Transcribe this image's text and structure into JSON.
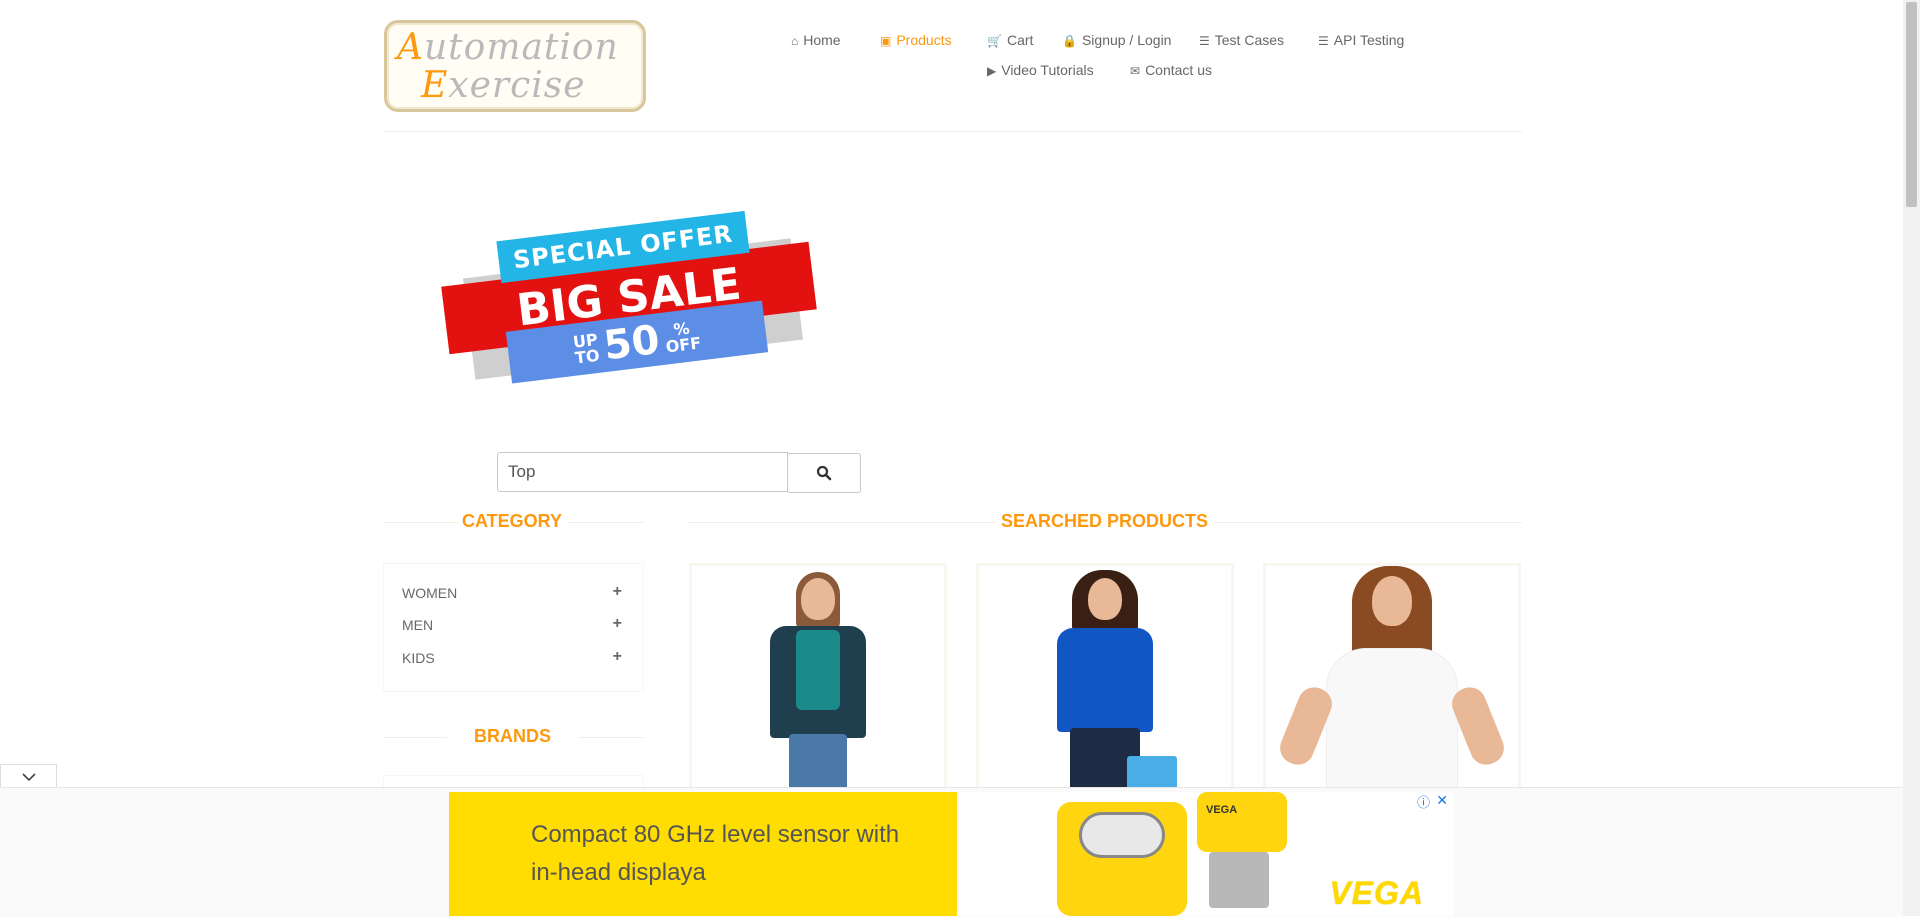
{
  "logo": {
    "line1_cap": "A",
    "line1_rest": "utomation",
    "line2_cap": "E",
    "line2_rest": "xercise"
  },
  "nav": [
    {
      "label": "Home",
      "icon": "home-icon"
    },
    {
      "label": "Products",
      "icon": "products-icon",
      "active": true
    },
    {
      "label": "Cart",
      "icon": "cart-icon"
    },
    {
      "label": "Signup / Login",
      "icon": "lock-icon"
    },
    {
      "label": "Test Cases",
      "icon": "list-icon"
    },
    {
      "label": "API Testing",
      "icon": "list-icon"
    },
    {
      "label": "Video Tutorials",
      "icon": "youtube-icon"
    },
    {
      "label": "Contact us",
      "icon": "envelope-icon"
    }
  ],
  "banner": {
    "special_offer": "SPECIAL OFFER",
    "big_sale": "BIG SALE",
    "up": "UP",
    "to": "TO",
    "percent_value": "50",
    "percent_sign": "%",
    "off": "OFF"
  },
  "search": {
    "value": "Top"
  },
  "sidebar": {
    "category_title": "CATEGORY",
    "categories": [
      "WOMEN",
      "MEN",
      "KIDS"
    ],
    "brands_title": "BRANDS"
  },
  "main": {
    "title": "SEARCHED PRODUCTS"
  },
  "ad": {
    "text": "Compact 80 GHz level sensor with in-head displaya",
    "brand": "VEGA",
    "sensor_label": "VEGA",
    "close": "✕",
    "info": "ⓘ"
  },
  "colors": {
    "accent": "#fe980f",
    "ad_yellow": "#ffdd00"
  }
}
